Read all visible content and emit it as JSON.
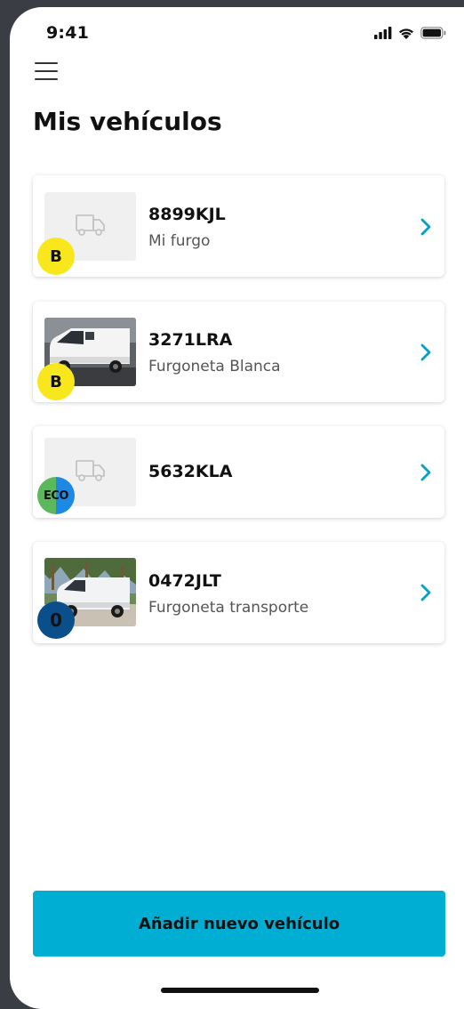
{
  "status_bar": {
    "time": "9:41",
    "icons": [
      "cellular-signal-icon",
      "wifi-icon",
      "battery-icon"
    ]
  },
  "header": {
    "menu_icon": "hamburger-menu-icon",
    "title": "Mis vehículos"
  },
  "vehicles": [
    {
      "plate": "8899KJL",
      "nickname": "Mi furgo",
      "image": "van-placeholder-icon",
      "label": "B",
      "label_colors": [
        "#f8e71c"
      ]
    },
    {
      "plate": "3271LRA",
      "nickname": "Furgoneta Blanca",
      "image": "white-van-photo",
      "label": "B",
      "label_colors": [
        "#f8e71c"
      ]
    },
    {
      "plate": "5632KLA",
      "nickname": "",
      "image": "van-placeholder-icon",
      "label": "ECO",
      "label_colors": [
        "#5cb85c",
        "#1e88e5"
      ]
    },
    {
      "plate": "0472JLT",
      "nickname": "Furgoneta transporte",
      "image": "white-van-palms-photo",
      "label": "0",
      "label_colors": [
        "#0b4f8a"
      ]
    }
  ],
  "actions": {
    "add_vehicle_label": "Añadir nuevo vehículo"
  },
  "colors": {
    "accent": "#00aed4",
    "chevron": "#00a2c7",
    "badge_b": "#f8e71c",
    "badge_eco_green": "#5cb85c",
    "badge_eco_blue": "#1e88e5",
    "badge_zero": "#0b4f8a"
  }
}
